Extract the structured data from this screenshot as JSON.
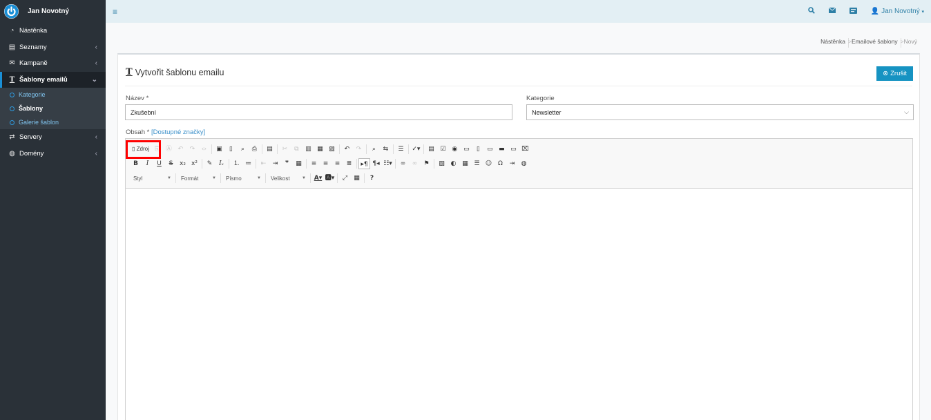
{
  "user": {
    "name": "Jan Novotný"
  },
  "sidebar": {
    "items": [
      {
        "label": "Nástěnka",
        "icon": "dashboard-icon"
      },
      {
        "label": "Seznamy",
        "icon": "list-icon"
      },
      {
        "label": "Kampaně",
        "icon": "envelope-icon"
      },
      {
        "label": "Šablony emailů",
        "icon": "text-icon"
      },
      {
        "label": "Servery",
        "icon": "exchange-icon"
      },
      {
        "label": "Domény",
        "icon": "globe-icon"
      }
    ],
    "subitems": [
      {
        "label": "Kategorie"
      },
      {
        "label": "Šablony"
      },
      {
        "label": "Galerie šablon"
      }
    ]
  },
  "breadcrumb": [
    "Nástěnka",
    "Emailové šablony",
    "Nový"
  ],
  "page": {
    "title": "Vytvořit šablonu emailu",
    "cancel_label": "Zrušit"
  },
  "form": {
    "name_label": "Název *",
    "name_value": "Zkušební",
    "category_label": "Kategorie",
    "category_value": "Newsletter",
    "content_label": "Obsah *",
    "content_link": "[Dostupné značky]"
  },
  "editor": {
    "source_label": "Zdroj",
    "combos": [
      "Styl",
      "Formát",
      "Písmo",
      "Velikost"
    ]
  },
  "colors": {
    "accent": "#1693c2",
    "sidebar": "#2a3138",
    "highlight": "#ff0000"
  }
}
